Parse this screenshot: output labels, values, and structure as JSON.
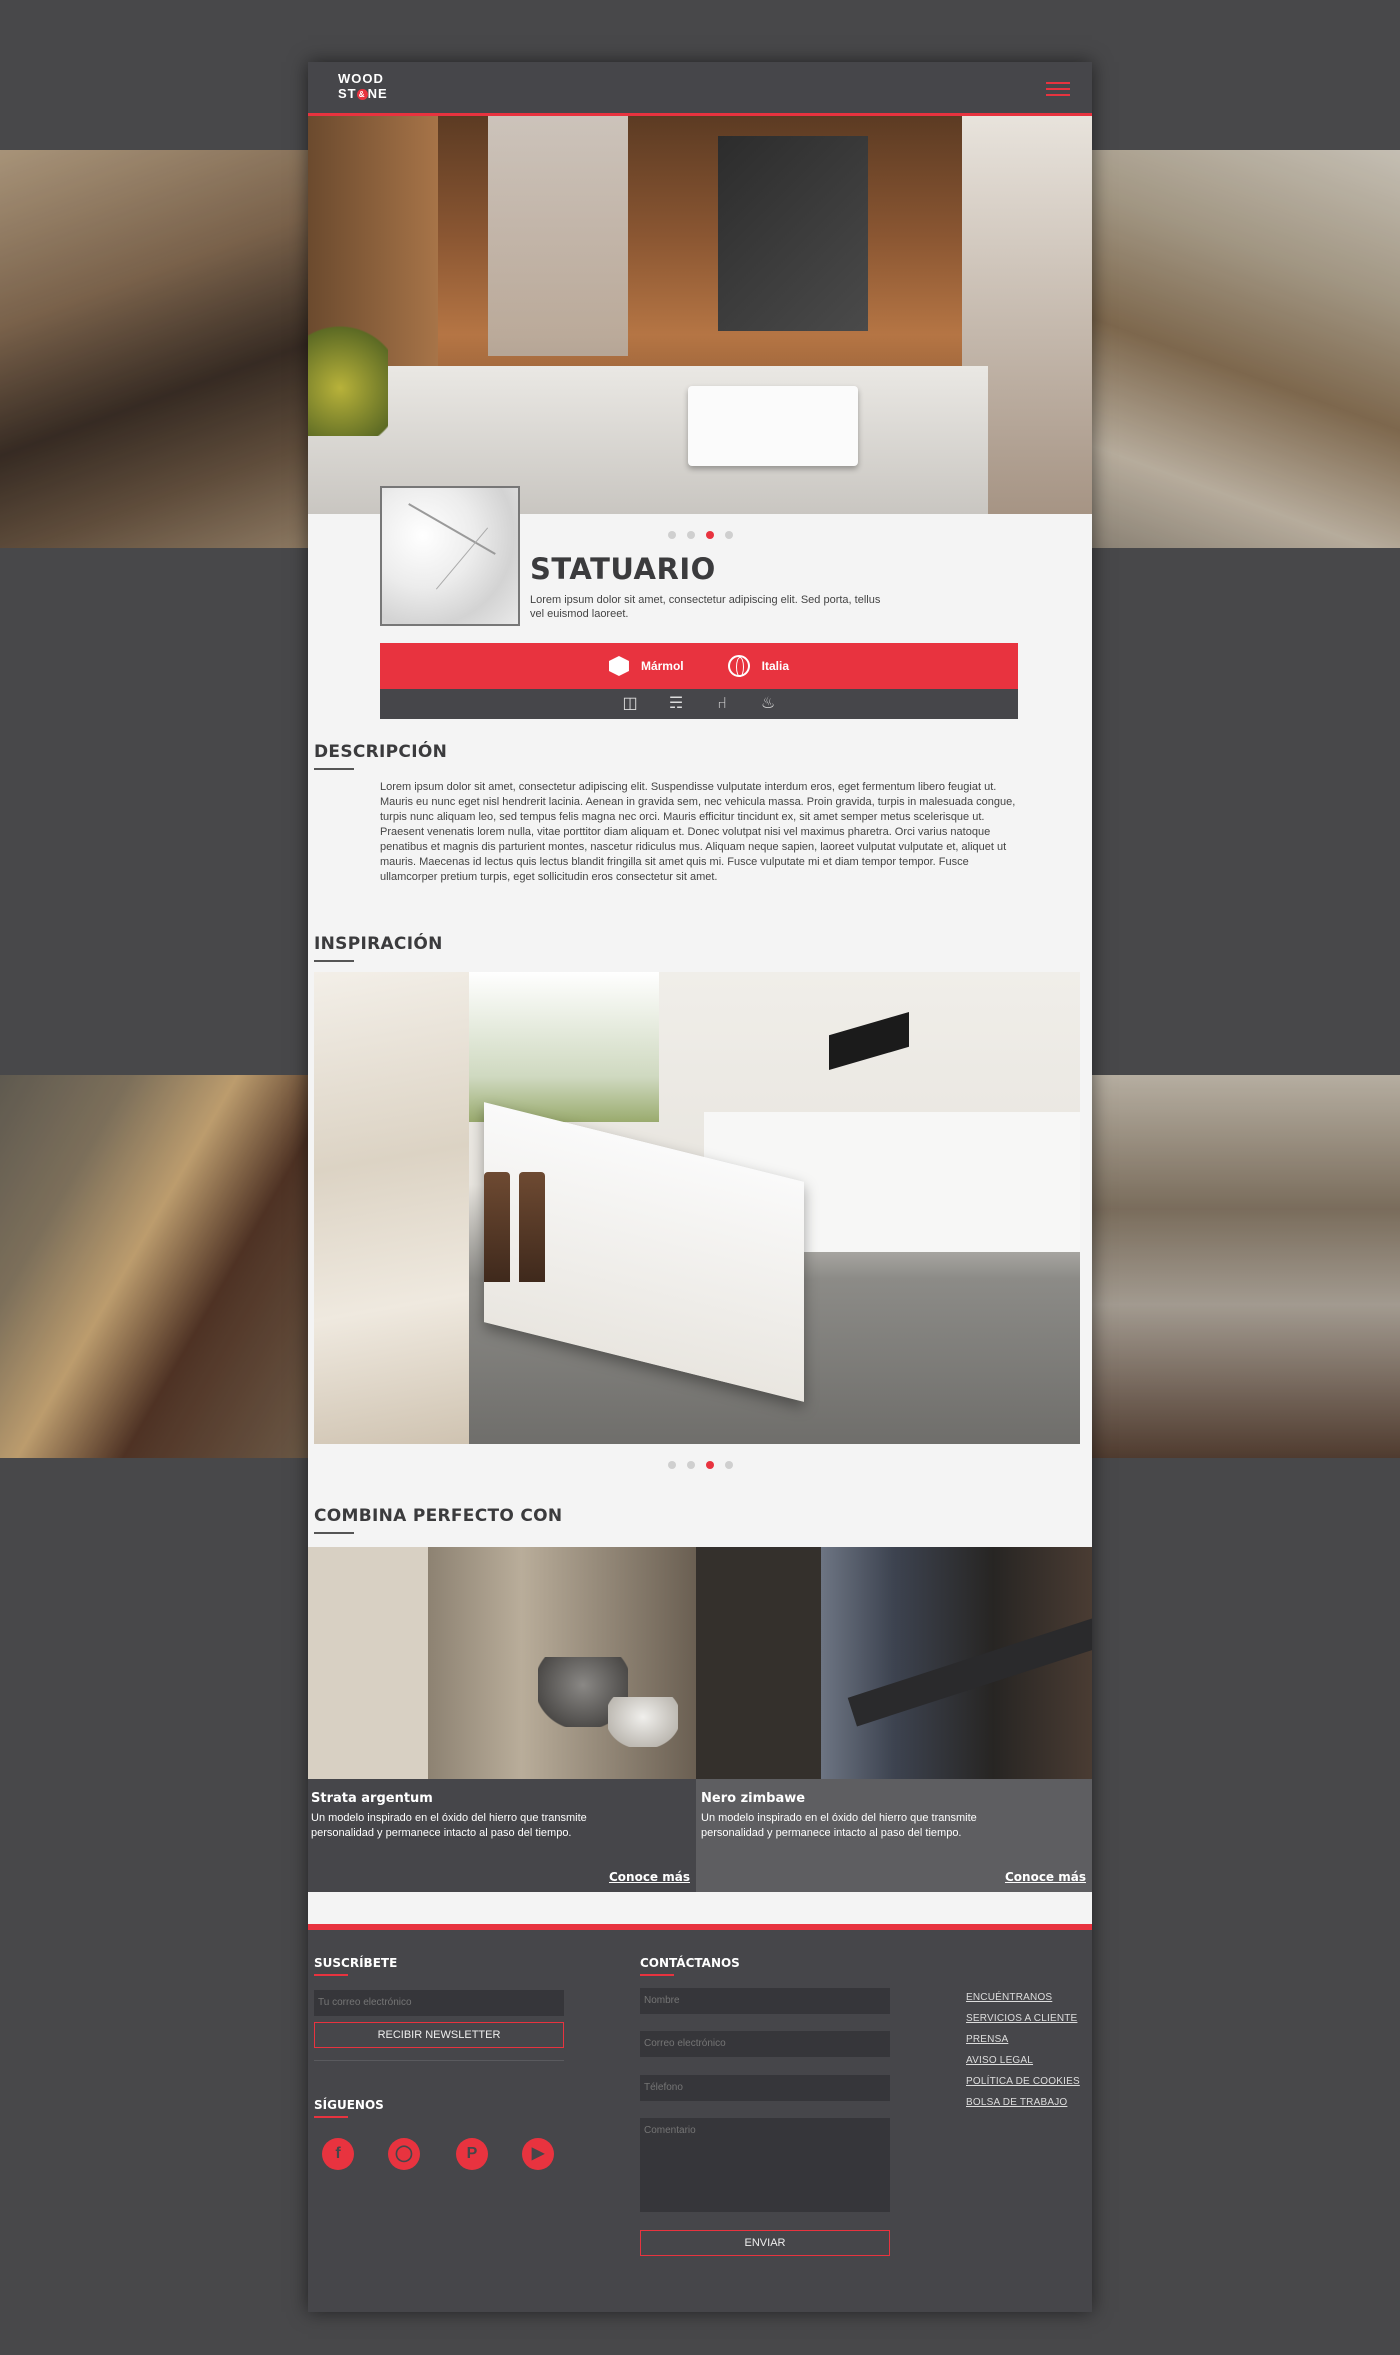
{
  "header": {
    "logo_top": "WOOD",
    "logo_bottom_a": "ST",
    "logo_amp": "&",
    "logo_bottom_b": "NE",
    "menu_icon": "hamburger-icon"
  },
  "product": {
    "name": "STATUARIO",
    "summary": "Lorem ipsum dolor sit amet, consectetur adipiscing elit. Sed porta, tellus vel euismod laoreet.",
    "material": "Mármol",
    "origin": "Italia",
    "uses": [
      "bathroom-sink-icon",
      "shower-icon",
      "bathtub-icon",
      "kitchen-icon"
    ]
  },
  "description": {
    "title": "DESCRIPCIÓN",
    "body": "Lorem ipsum dolor sit amet, consectetur adipiscing elit. Suspendisse vulputate interdum eros, eget fermentum libero feugiat ut. Mauris eu nunc eget nisl hendrerit lacinia. Aenean in gravida sem, nec vehicula massa. Proin gravida, turpis in malesuada congue, turpis nunc aliquam leo, sed tempus felis magna nec orci. Mauris efficitur tincidunt ex, sit amet semper metus scelerisque ut. Praesent venenatis lorem nulla, vitae porttitor diam aliquam et. Donec volutpat nisi vel maximus pharetra. Orci varius natoque penatibus et magnis dis parturient montes, nascetur ridiculus mus. Aliquam neque sapien, laoreet vulputat vulputate et, aliquet ut mauris. Maecenas id lectus quis lectus blandit fringilla sit amet quis mi. Fusce vulputate mi et diam tempor tempor. Fusce ullamcorper pretium turpis, eget sollicitudin eros consectetur sit amet."
  },
  "inspiration": {
    "title": "INSPIRACIÓN"
  },
  "carousel": {
    "slides": 4,
    "active": 3
  },
  "combina": {
    "title": "COMBINA PERFECTO CON",
    "items": [
      {
        "name": "Strata argentum",
        "blurb": "Un modelo inspirado en el óxido del hierro que transmite personalidad y permanece intacto al paso del tiempo.",
        "link": "Conoce más"
      },
      {
        "name": "Nero zimbawe",
        "blurb": "Un modelo inspirado en el óxido del hierro que transmite personalidad y permanece intacto al paso del tiempo.",
        "link": "Conoce más"
      }
    ]
  },
  "footer": {
    "subscribe_title": "SUSCRÍBETE",
    "email_placeholder": "Tu correo electrónico",
    "newsletter_button": "RECIBIR NEWSLETTER",
    "follow_title": "SÍGUENOS",
    "social": [
      "facebook-icon",
      "instagram-icon",
      "pinterest-icon",
      "youtube-icon"
    ],
    "contact_title": "CONTÁCTANOS",
    "name_placeholder": "Nombre",
    "mail_placeholder": "Correo electrónico",
    "phone_placeholder": "Télefono",
    "comment_placeholder": "Comentario",
    "send_button": "ENVIAR",
    "links": [
      "ENCUÉNTRANOS",
      "SERVICIOS A CLIENTE",
      "PRENSA",
      "AVISO LEGAL",
      "POLÍTICA  DE COOKIES",
      "BOLSA DE TRABAJO"
    ]
  },
  "colors": {
    "accent": "#e8333f",
    "dark": "#46464a",
    "page": "#f4f4f4",
    "backdrop": "#48484a"
  }
}
